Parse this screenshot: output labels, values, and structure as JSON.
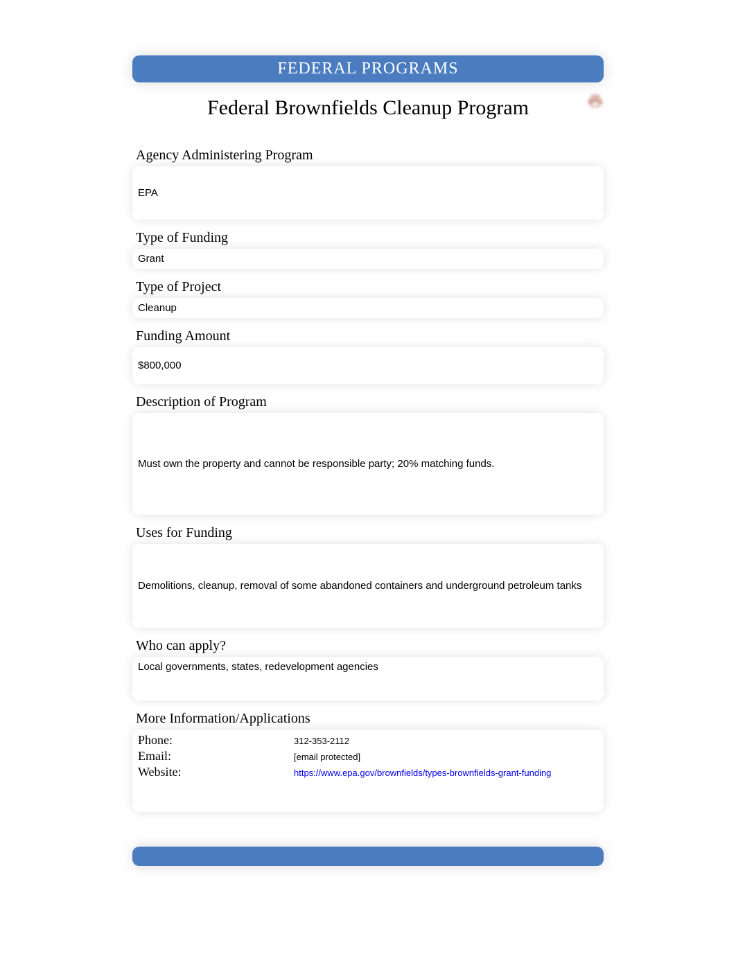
{
  "header": {
    "category": "FEDERAL PROGRAMS",
    "title": "Federal Brownfields Cleanup Program"
  },
  "fields": {
    "agency": {
      "label": "Agency Administering Program",
      "value": "EPA"
    },
    "funding_type": {
      "label": "Type of Funding",
      "value": "Grant"
    },
    "project_type": {
      "label": "Type of Project",
      "value": "Cleanup"
    },
    "funding_amount": {
      "label": "Funding Amount",
      "value": "$800,000"
    },
    "description": {
      "label": "Description of Program",
      "value": "Must own the property and cannot be responsible party; 20% matching funds."
    },
    "uses": {
      "label": "Uses for Funding",
      "value": "Demolitions, cleanup, removal of some abandoned containers and underground petroleum tanks"
    },
    "who_apply": {
      "label": "Who can apply?",
      "value": "Local governments, states, redevelopment agencies"
    }
  },
  "contact": {
    "heading": "More Information/Applications",
    "phone_label": "Phone:",
    "phone_value": "312-353-2112",
    "email_label": "Email:",
    "email_value": "[email protected]",
    "website_label": "Website:",
    "website_value": "https://www.epa.gov/brownfields/types-brownfields-grant-funding"
  }
}
